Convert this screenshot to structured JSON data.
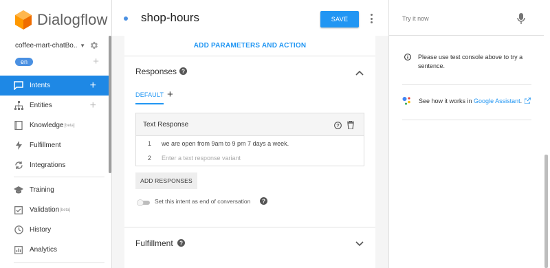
{
  "brand": {
    "name": "Dialogflow"
  },
  "agent": {
    "name": "coffee-mart-chatBo...",
    "language": "en"
  },
  "nav": [
    {
      "label": "Intents",
      "badge": ""
    },
    {
      "label": "Entities",
      "badge": ""
    },
    {
      "label": "Knowledge",
      "badge": "[beta]"
    },
    {
      "label": "Fulfillment",
      "badge": ""
    },
    {
      "label": "Integrations",
      "badge": ""
    },
    {
      "label": "Training",
      "badge": ""
    },
    {
      "label": "Validation",
      "badge": "[beta]"
    },
    {
      "label": "History",
      "badge": ""
    },
    {
      "label": "Analytics",
      "badge": ""
    }
  ],
  "intent": {
    "name": "shop-hours",
    "save_label": "SAVE",
    "params_link": "ADD PARAMETERS AND ACTION"
  },
  "responses": {
    "title": "Responses",
    "tab_default": "DEFAULT",
    "text_response_title": "Text Response",
    "rows": [
      {
        "num": "1",
        "text": "we are open from 9am to 9 pm 7 days a week."
      },
      {
        "num": "2",
        "placeholder": "Enter a text response variant"
      }
    ],
    "add_label": "ADD RESPONSES",
    "end_conversation_label": "Set this intent as end of conversation"
  },
  "fulfillment": {
    "title": "Fulfillment"
  },
  "console": {
    "placeholder": "Try it now",
    "info": "Please use test console above to try a sentence.",
    "ga_prefix": "See how it works in ",
    "ga_link": "Google Assistant",
    "ga_suffix": "."
  },
  "colors": {
    "accent": "#2196f3",
    "nav_active": "#1e88e5",
    "lang_pill": "#4a90e2"
  }
}
